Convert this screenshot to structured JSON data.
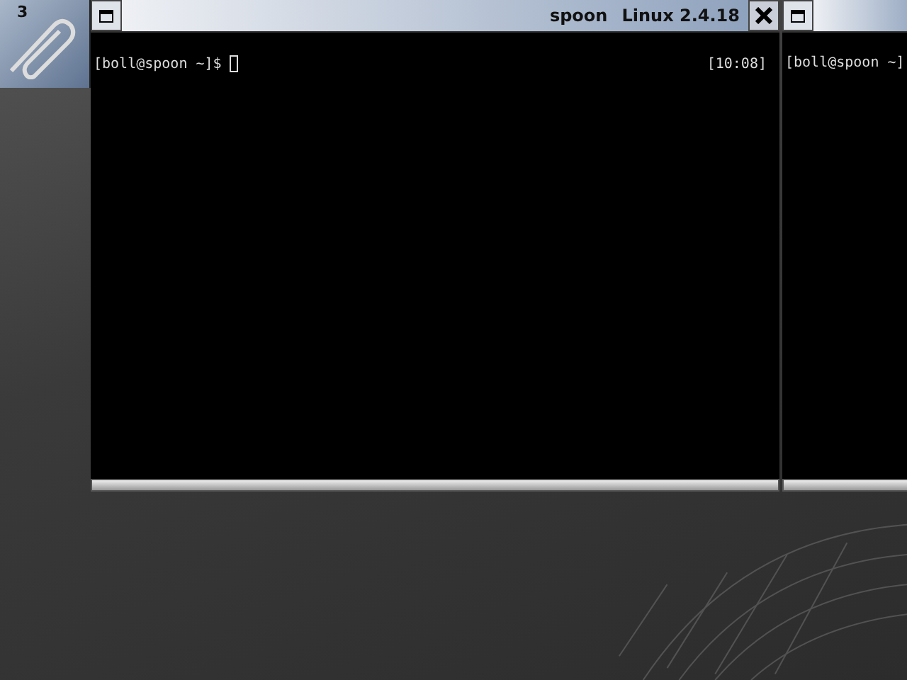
{
  "pager": {
    "workspace": "3"
  },
  "windows": [
    {
      "host": "spoon",
      "kernel": "Linux 2.4.18",
      "prompt": "[boll@spoon ~]$",
      "cursor": true,
      "clock": "[10:08]",
      "close": true
    },
    {
      "prompt": "[boll@spoon ~]"
    }
  ]
}
